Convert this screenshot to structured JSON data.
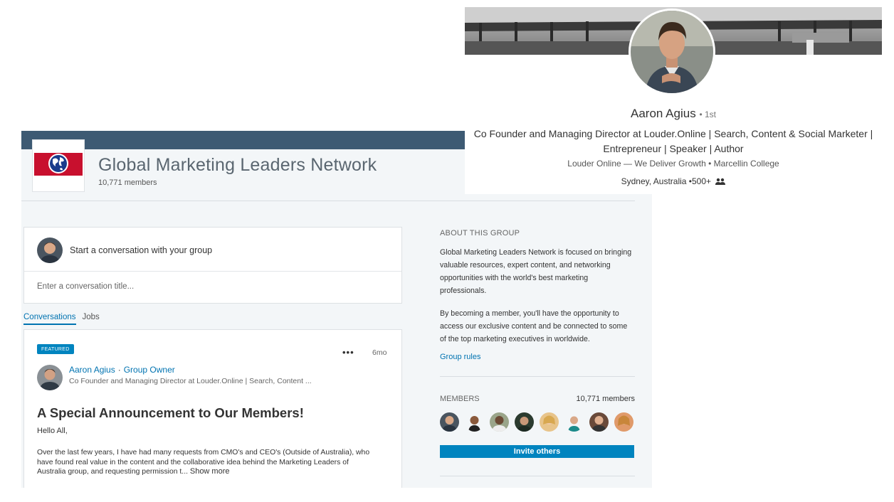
{
  "group": {
    "name": "Global Marketing Leaders Network",
    "members_label": "10,771 members"
  },
  "composer": {
    "prompt": "Start a conversation with your group",
    "title_placeholder": "Enter a conversation title..."
  },
  "tabs": [
    {
      "label": "Conversations",
      "active": true
    },
    {
      "label": "Jobs",
      "active": false
    }
  ],
  "post": {
    "badge": "FEATURED",
    "menu_icon": "more-dots-icon",
    "time": "6mo",
    "author_name": "Aaron Agius",
    "author_role": "Group Owner",
    "author_headline": "Co Founder and Managing Director at Louder.Online | Search, Content ...",
    "title": "A Special Announcement to Our Members!",
    "greeting": "Hello All,",
    "body": "Over the last few years, I have had many requests from CMO's and CEO's (Outside of Australia), who have found real value in the content and the collaborative idea behind the Marketing Leaders of Australia group, and requesting permission t...",
    "show_more": "Show more"
  },
  "sidebar": {
    "about_heading": "ABOUT THIS GROUP",
    "about_para1": "Global Marketing Leaders Network is focused on bringing valuable resources, expert content, and networking opportunities with the world's best marketing professionals.",
    "about_para2": "By becoming a member, you'll have the opportunity to access our exclusive content and be connected to some of the top marketing executives in worldwide.",
    "group_rules": "Group rules",
    "members_heading": "MEMBERS",
    "members_count": "10,771 members",
    "invite_label": "Invite others"
  },
  "profile": {
    "name": "Aaron Agius",
    "degree": "• 1st",
    "headline": "Co Founder and Managing Director at Louder.Online | Search, Content & Social Marketer | Entrepreneur | Speaker | Author",
    "sub": "Louder Online — We Deliver Growth • Marcellin College",
    "location": "Sydney, Australia",
    "connections": "•500+",
    "connections_icon": "people-icon"
  },
  "colors": {
    "brand_blue": "#0073b1",
    "button_blue": "#0084bf",
    "banner": "#3d5a73",
    "panel_bg": "#f3f6f8"
  }
}
